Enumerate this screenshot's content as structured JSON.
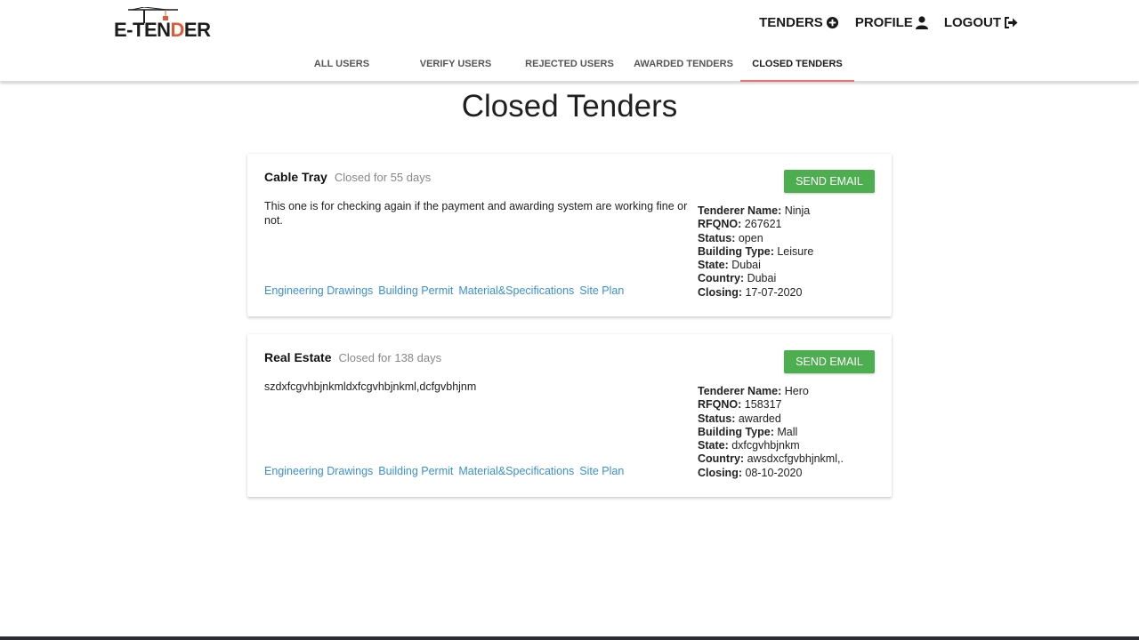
{
  "brand": {
    "pre": "E-",
    "mid": "TEN",
    "accent": "D",
    "post": "ER"
  },
  "topnav": [
    {
      "label": "TENDERS",
      "icon": "plus-circle-icon"
    },
    {
      "label": "PROFILE",
      "icon": "user-icon"
    },
    {
      "label": "LOGOUT",
      "icon": "logout-icon"
    }
  ],
  "tabs": [
    {
      "label": "ALL USERS",
      "active": false
    },
    {
      "label": "VERIFY USERS",
      "active": false
    },
    {
      "label": "REJECTED USERS",
      "active": false
    },
    {
      "label": "AWARDED TENDERS",
      "active": false
    },
    {
      "label": "CLOSED TENDERS",
      "active": true
    }
  ],
  "page_title": "Closed Tenders",
  "colors": {
    "accent_tab": "#ee6e73",
    "button": "#4cae4f",
    "link": "#3a90d6"
  },
  "labels": {
    "send_email": "SEND EMAIL",
    "tenderer_name": "Tenderer Name:",
    "rfqno": "RFQNO:",
    "status": "Status:",
    "building_type": "Building Type:",
    "state": "State:",
    "country": "Country:",
    "closing": "Closing:"
  },
  "tenders": [
    {
      "title": "Cable Tray",
      "closed_for": "Closed for 55 days",
      "description": "This one is for checking again if the payment and awarding system are working fine or not.",
      "links": [
        "Engineering Drawings",
        "Building Permit",
        "Material&Specifications",
        "Site Plan"
      ],
      "tenderer_name": "Ninja",
      "rfqno": "267621",
      "status": "open",
      "building_type": "Leisure",
      "state": "Dubai",
      "country": "Dubai",
      "closing": "17-07-2020"
    },
    {
      "title": "Real Estate",
      "closed_for": "Closed for 138 days",
      "description": "szdxfcgvhbjnkmldxfcgvhbjnkml,dcfgvbhjnm",
      "links": [
        "Engineering Drawings",
        "Building Permit",
        "Material&Specifications",
        "Site Plan"
      ],
      "tenderer_name": "Hero",
      "rfqno": "158317",
      "status": "awarded",
      "building_type": "Mall",
      "state": "dxfcgvhbjnkm",
      "country": "awsdxcfgvbhjnkml,.",
      "closing": "08-10-2020"
    }
  ]
}
